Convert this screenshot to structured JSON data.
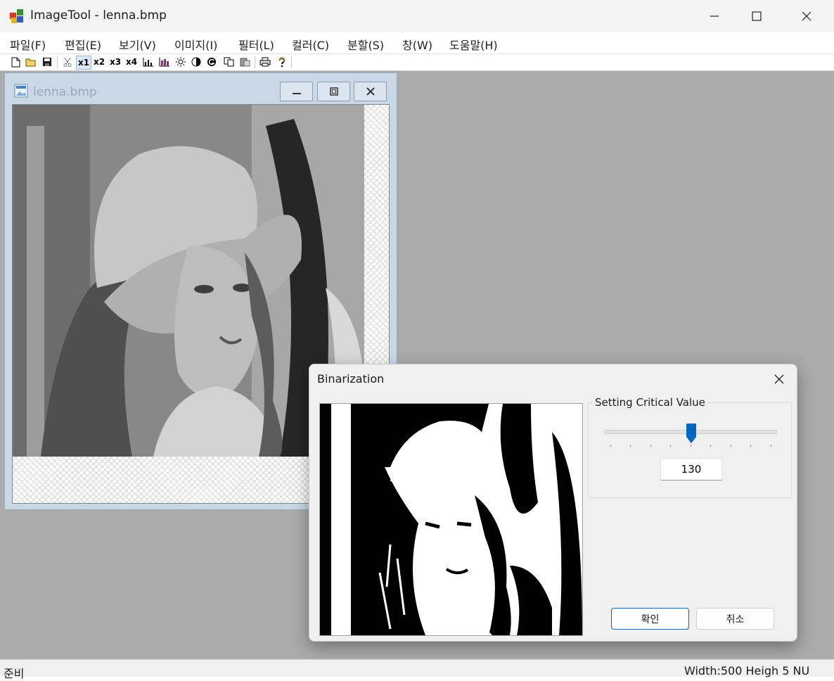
{
  "app": {
    "title": "ImageTool - lenna.bmp"
  },
  "menu": [
    "파일(F)",
    "편집(E)",
    "보기(V)",
    "이미지(I)",
    "필터(L)",
    "컬러(C)",
    "분할(S)",
    "창(W)",
    "도움말(H)"
  ],
  "toolbar": {
    "zoom_x1": "x1",
    "zoom_x2": "x2",
    "zoom_x3": "x3",
    "zoom_x4": "x4"
  },
  "child_window": {
    "title": "lenna.bmp"
  },
  "dialog": {
    "title": "Binarization",
    "group_label": "Setting Critical Value",
    "threshold_value": "130",
    "ok_label": "확인",
    "cancel_label": "취소"
  },
  "slider": {
    "fraction": 0.51
  },
  "status": {
    "left": "준비",
    "right": "Width:500 Heigh  5 NU"
  },
  "colors": {
    "accent": "#0067c0",
    "mdi_background": "#ababab",
    "child_frame": "#cad8e6"
  }
}
